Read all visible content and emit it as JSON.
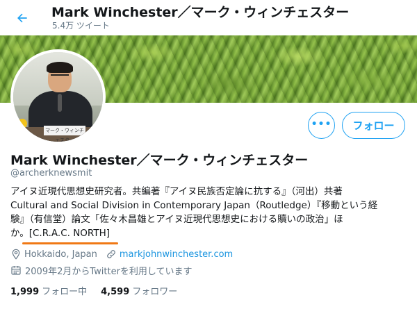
{
  "header": {
    "name": "Mark Winchester／マーク・ウィンチェスター",
    "tweet_count": "5.4万 ツイート"
  },
  "profile": {
    "display_name": "Mark Winchester／マーク・ウィンチェスター",
    "handle": "@archerknewsmit",
    "avatar_sign_text": "マーク・ウィンチェスター",
    "bio_lines": [
      "アイヌ近現代思想史研究者。共編著『アイヌ民族否定論に抗する』（河出）共著",
      "Cultural and Social Division in Contemporary Japan（Routledge）『移動という経",
      "験』（有信堂）論文「佐々木昌雄とアイヌ近現代思想史における贖いの政治」ほ",
      "か。"
    ],
    "bio_highlight": "[C.R.A.C. NORTH]",
    "location": "Hokkaido, Japan",
    "website": "markjohnwinchester.com",
    "joined": "2009年2月からTwitterを利用しています"
  },
  "actions": {
    "more_label": "•••",
    "follow_label": "フォロー"
  },
  "stats": {
    "following_count": "1,999",
    "following_label": "フォロー中",
    "followers_count": "4,599",
    "followers_label": "フォロワー"
  },
  "colors": {
    "accent": "#1da1f2",
    "link": "#1b95e0",
    "secondary_text": "#657786",
    "highlight_underline": "#f07814"
  },
  "icons": {
    "back": "back-arrow-icon",
    "location": "location-pin-icon",
    "website": "link-icon",
    "joined": "calendar-icon"
  }
}
